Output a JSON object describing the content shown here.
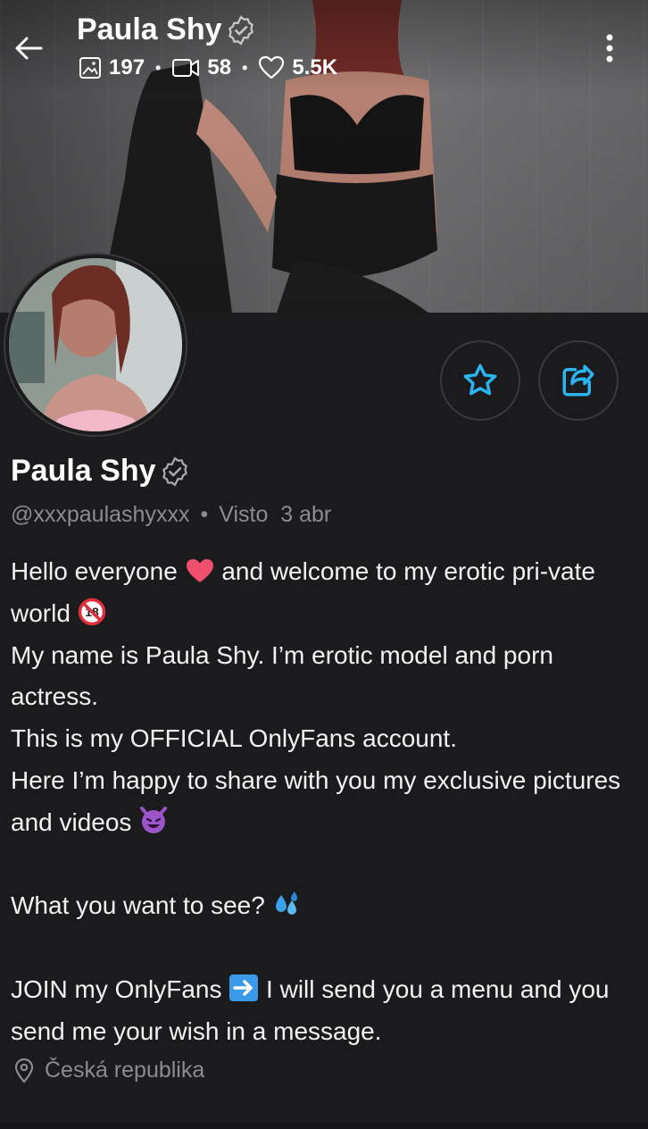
{
  "header": {
    "name": "Paula Shy",
    "stats": {
      "photos": "197",
      "videos": "58",
      "likes": "5.5K"
    },
    "stat_separator": "•"
  },
  "profile": {
    "name": "Paula Shy",
    "username": "@xxxpaulashyxxx",
    "meta_separator": "•",
    "last_seen": "Visto  3 abr",
    "bio": {
      "line1_a": "Hello everyone",
      "line1_b": "and welcome to my erotic pri-vate world",
      "line2": "My name is Paula Shy. I’m erotic model and porn actress.",
      "line3": "This is my OFFICIAL OnlyFans account.",
      "line4": "Here I’m happy to share with you my exclusive pictures and videos",
      "line5": "What you want to see?",
      "line6_a": "JOIN my OnlyFans",
      "line6_b": "I will send you a menu and you send me your wish in a message."
    },
    "location": "Česká republika"
  },
  "icons": {
    "verified": "verified-badge-icon",
    "favorite": "star-icon",
    "share": "share-icon"
  },
  "colors": {
    "background": "#1b1b1d",
    "accent": "#2ab5f0",
    "muted_text": "#8a8c92"
  }
}
